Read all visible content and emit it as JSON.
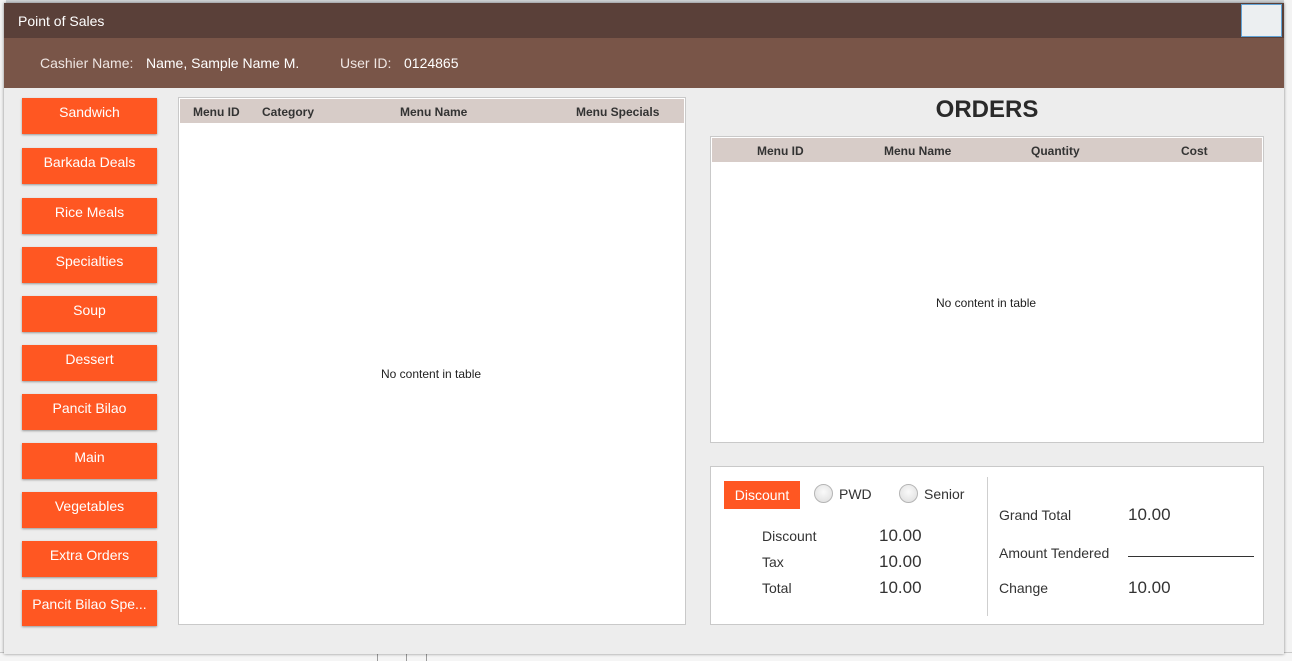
{
  "window": {
    "title": "Point of Sales"
  },
  "cashier": {
    "name_label": "Cashier Name:",
    "name_value": "Name, Sample Name M.",
    "id_label": "User ID:",
    "id_value": "0124865"
  },
  "categories": [
    "Sandwich",
    "Barkada Deals",
    "Rice Meals",
    "Specialties",
    "Soup",
    "Dessert",
    "Pancit Bilao",
    "Main",
    "Vegetables",
    "Extra Orders",
    "Pancit Bilao Spe..."
  ],
  "menu_table": {
    "columns": [
      "Menu ID",
      "Category",
      "Menu Name",
      "Menu Specials"
    ],
    "empty_text": "No content in table"
  },
  "orders": {
    "title": "ORDERS",
    "columns": [
      "Menu ID",
      "Menu Name",
      "Quantity",
      "Cost"
    ],
    "empty_text": "No content in table"
  },
  "summary": {
    "discount_button": "Discount",
    "pwd_label": "PWD",
    "senior_label": "Senior",
    "discount_label": "Discount",
    "discount_value": "10.00",
    "tax_label": "Tax",
    "tax_value": "10.00",
    "total_label": "Total",
    "total_value": "10.00",
    "grand_total_label": "Grand Total",
    "grand_total_value": "10.00",
    "amount_tendered_label": "Amount Tendered",
    "amount_tendered_value": "",
    "change_label": "Change",
    "change_value": "10.00"
  },
  "colors": {
    "titlebar": "#5a4039",
    "infobar": "#795548",
    "accent": "#ff5722",
    "table_header": "#d7ccc8"
  }
}
